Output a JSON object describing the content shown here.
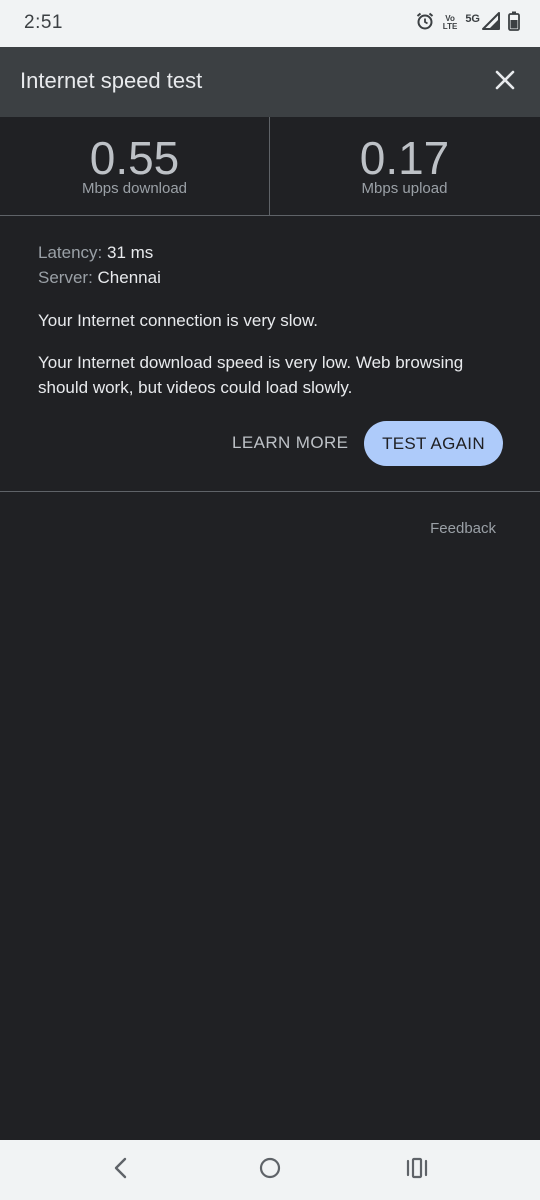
{
  "status_bar": {
    "time": "2:51",
    "volte_line1": "Vo",
    "volte_line2": "LTE",
    "network": "5G",
    "icons": [
      "alarm-icon",
      "volte-icon",
      "signal-icon",
      "battery-icon"
    ]
  },
  "header": {
    "title": "Internet speed test",
    "close_icon": "close-icon"
  },
  "results": {
    "download_value": "0.55",
    "download_label": "Mbps download",
    "upload_value": "0.17",
    "upload_label": "Mbps upload"
  },
  "details": {
    "latency_key": "Latency:",
    "latency_value": "31 ms",
    "server_key": "Server:",
    "server_value": "Chennai",
    "message_connection": "Your Internet connection is very slow.",
    "message_download": "Your Internet download speed is very low. Web browsing should work, but videos could load slowly."
  },
  "actions": {
    "learn_more": "LEARN MORE",
    "test_again": "TEST AGAIN",
    "feedback": "Feedback"
  },
  "colors": {
    "background": "#202124",
    "header": "#3c4043",
    "accent_button": "#aecbfa",
    "system_bars": "#f1f3f4"
  },
  "nav_bar": {
    "icons": [
      "back-icon",
      "home-icon",
      "recents-icon"
    ]
  }
}
